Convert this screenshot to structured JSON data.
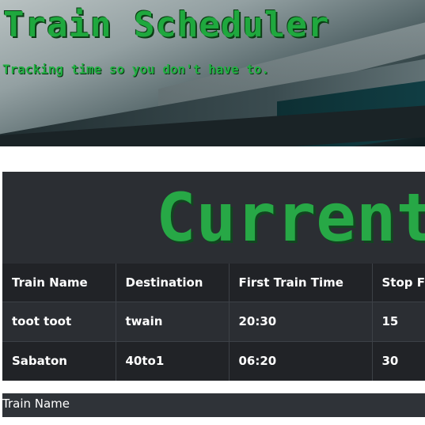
{
  "header": {
    "title": "Train Scheduler",
    "tagline": "Tracking time so you don't have to."
  },
  "schedule": {
    "heading": "Current Train Schedule",
    "columns": [
      "Train Name",
      "Destination",
      "First Train Time",
      "Stop Frequency"
    ],
    "rows": [
      [
        "toot toot",
        "twain",
        "20:30",
        "15"
      ],
      [
        "Sabaton",
        "40to1",
        "06:20",
        "30"
      ]
    ]
  },
  "form": {
    "train_name_label": "Train Name"
  },
  "colors": {
    "accent_green": "#1fa83e",
    "panel_dark": "#2b2e33",
    "table_header": "#212327"
  }
}
